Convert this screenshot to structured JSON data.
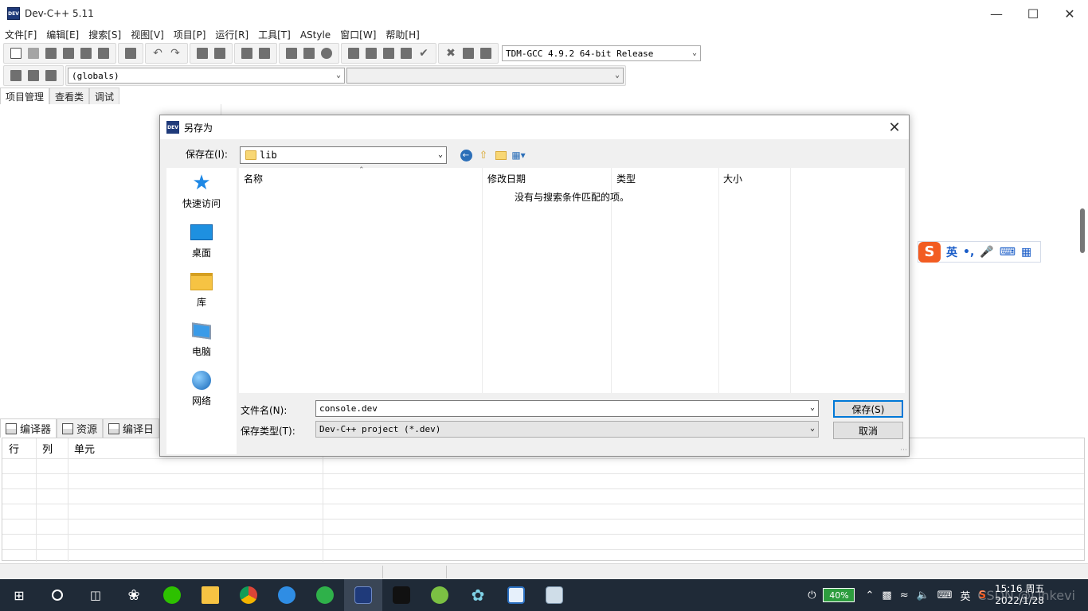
{
  "app": {
    "title": "Dev-C++ 5.11",
    "icon_text": "DEV"
  },
  "menu": [
    "文件[F]",
    "编辑[E]",
    "搜索[S]",
    "视图[V]",
    "项目[P]",
    "运行[R]",
    "工具[T]",
    "AStyle",
    "窗口[W]",
    "帮助[H]"
  ],
  "toolbar": {
    "compiler": "TDM-GCC 4.9.2 64-bit Release",
    "scope": "(globals)",
    "member": ""
  },
  "left_tabs": [
    "项目管理",
    "查看类",
    "调试"
  ],
  "bottom_tabs": [
    "编译器",
    "资源",
    "编译日"
  ],
  "grid_headers": [
    "行",
    "列",
    "单元"
  ],
  "ime": {
    "logo": "S",
    "lang": "英",
    "punct": "•,"
  },
  "dialog": {
    "title": "另存为",
    "save_in_label": "保存在(I):",
    "current_folder": "lib",
    "places": [
      {
        "label": "快速访问",
        "icon": "star-icon"
      },
      {
        "label": "桌面",
        "icon": "desktop-icon"
      },
      {
        "label": "库",
        "icon": "library-icon"
      },
      {
        "label": "电脑",
        "icon": "computer-icon"
      },
      {
        "label": "网络",
        "icon": "network-icon"
      }
    ],
    "columns": [
      "名称",
      "修改日期",
      "类型",
      "大小"
    ],
    "empty_message": "没有与搜索条件匹配的项。",
    "filename_label": "文件名(N):",
    "filename_value": "console.dev",
    "filetype_label": "保存类型(T):",
    "filetype_value": "Dev-C++ project (*.dev)",
    "save_button": "保存(S)",
    "cancel_button": "取消"
  },
  "taskbar": {
    "battery": "40%",
    "ime_lang": "英",
    "time": "15:16 周五",
    "date": "2022/1/28",
    "watermark": "CSDN @Linkevi"
  }
}
